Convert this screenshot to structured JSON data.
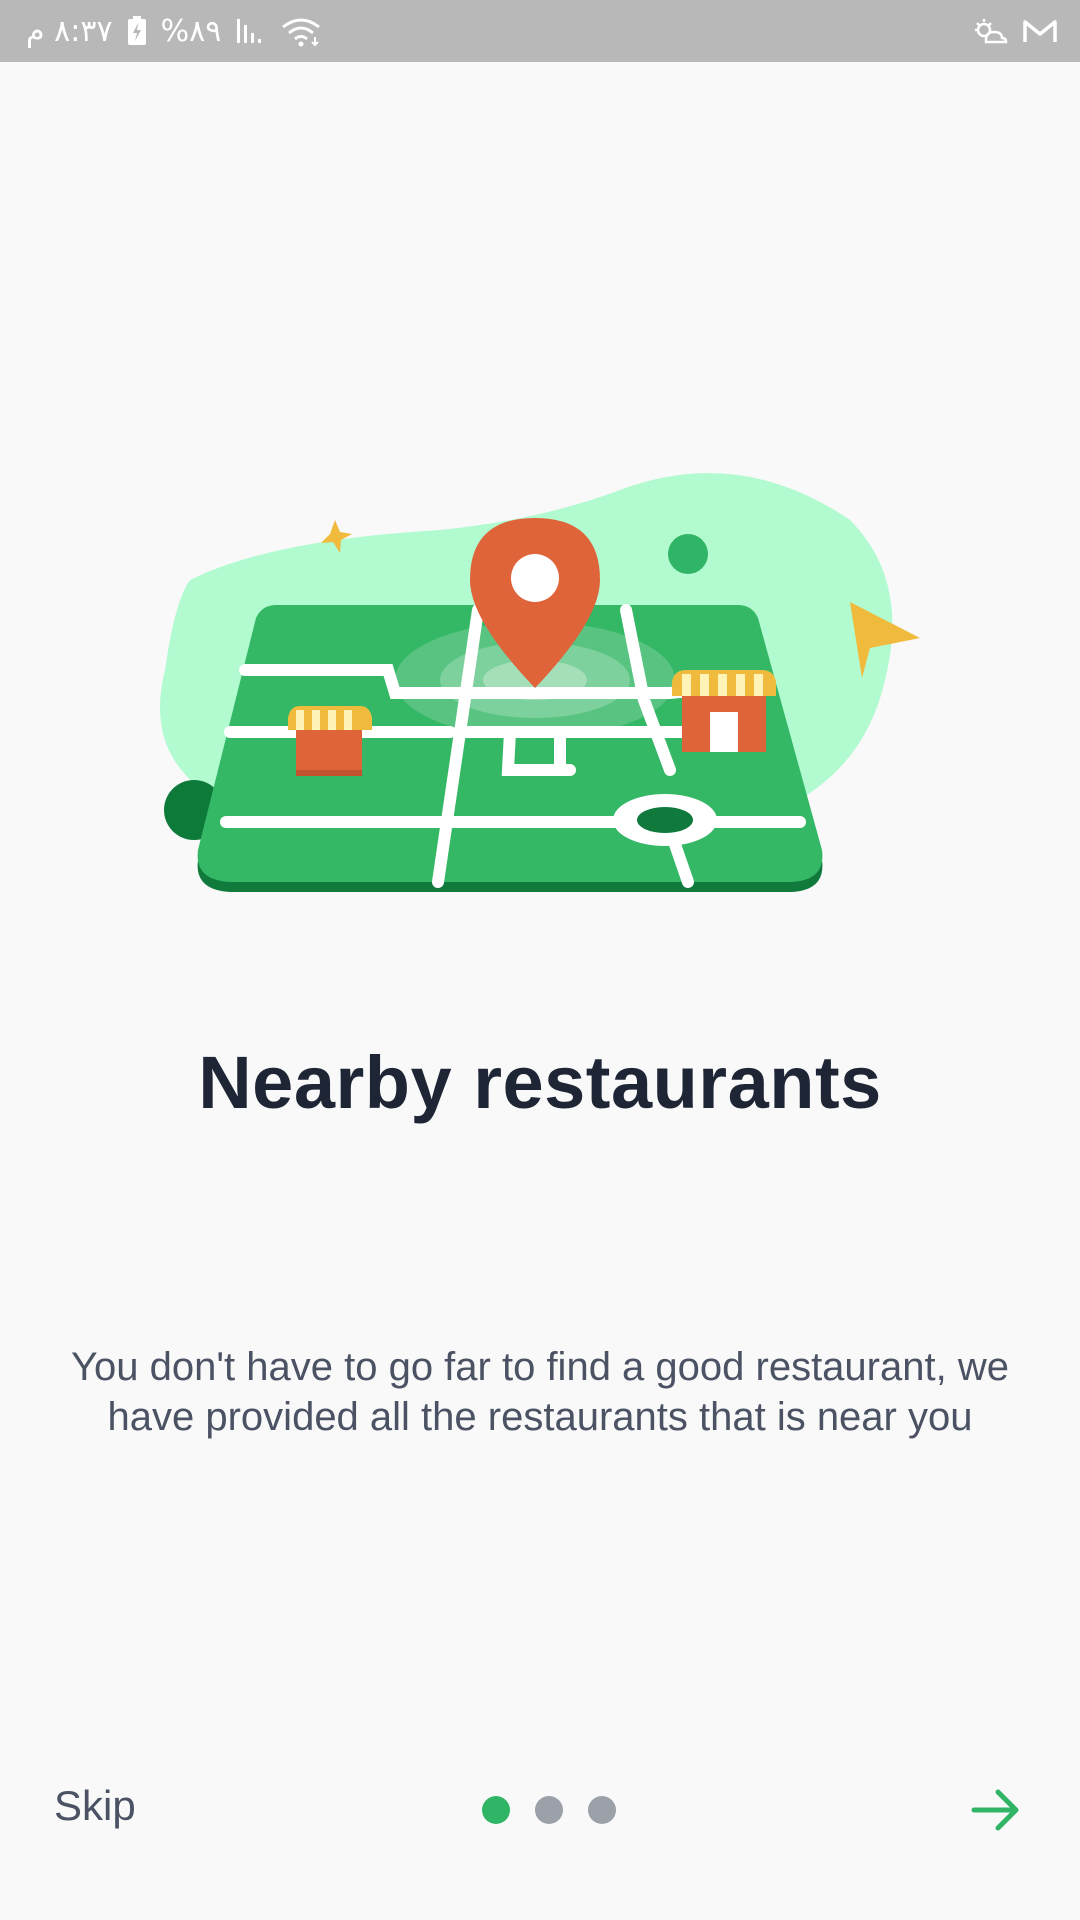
{
  "status_bar": {
    "time": "٨:٣٧ م",
    "battery": "%٨٩"
  },
  "onboarding": {
    "illustration": "map-with-restaurants-illustration",
    "title": "Nearby restaurants",
    "description": "You don't have to go far to find a good restaurant, we have provided all the restaurants that is near you",
    "skip_label": "Skip",
    "page_indicator": {
      "current": 1,
      "total": 3
    },
    "next_icon": "arrow-right-icon"
  },
  "colors": {
    "accent": "#2fb565",
    "title": "#1e2635",
    "body_text": "#4a5263",
    "inactive_dot": "#9ca0a8",
    "background": "#f9f9fa"
  }
}
